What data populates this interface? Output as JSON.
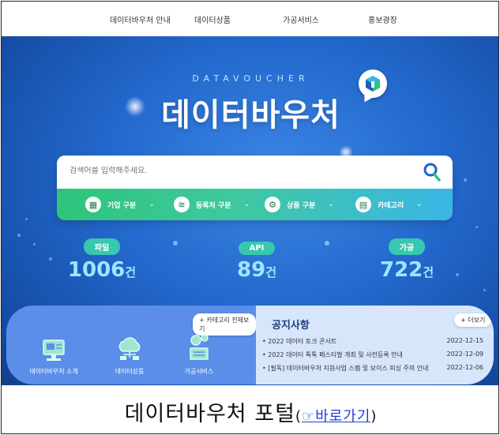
{
  "nav": {
    "items": [
      "데이터바우처 안내",
      "데이터상품",
      "가공서비스",
      "홍보광장"
    ]
  },
  "hero": {
    "tagline": "DATAVOUCHER",
    "title": "데이터바우처"
  },
  "search": {
    "placeholder": "검색어를 입력해주세요.",
    "filters": [
      {
        "label": "기업 구분",
        "icon": "building-icon"
      },
      {
        "label": "등록처 구분",
        "icon": "registry-icon"
      },
      {
        "label": "상품 구분",
        "icon": "product-icon"
      },
      {
        "label": "카테고리",
        "icon": "category-icon"
      }
    ]
  },
  "stats": [
    {
      "label": "파일",
      "value": "1006",
      "unit": "건"
    },
    {
      "label": "API",
      "value": "89",
      "unit": "건"
    },
    {
      "label": "가공",
      "value": "722",
      "unit": "건"
    }
  ],
  "quick": {
    "all_categories": "+ 카테고리 전체보기",
    "items": [
      {
        "label": "데이터바우처 소개",
        "icon": "monitor-icon"
      },
      {
        "label": "데이터상품",
        "icon": "cloud-data-icon"
      },
      {
        "label": "가공서비스",
        "icon": "processing-icon"
      }
    ]
  },
  "notice": {
    "title": "공지사항",
    "more": "+ 더보기",
    "items": [
      {
        "title": "2022 데이터 토크 콘서트",
        "date": "2022-12-15"
      },
      {
        "title": "2022 데이터 톡톡 페스티벌 개최 및 사전등록 안내",
        "date": "2022-12-09"
      },
      {
        "title": "[필독] 데이터바우처 지원사업 스펨 및 보이스 피싱 주의 안내",
        "date": "2022-12-06"
      }
    ]
  },
  "caption": {
    "text": "데이터바우처 포털",
    "open_paren": "(",
    "link_icon": "☞",
    "link": "바로가기",
    "close_paren": ")"
  },
  "colors": {
    "hero_blue": "#2368cc",
    "accent_green": "#2dc57a",
    "accent_teal": "#38c8b0",
    "stat_number": "#9fe6ff",
    "notice_bg": "#d7e6fb",
    "link": "#1a3fd6"
  }
}
